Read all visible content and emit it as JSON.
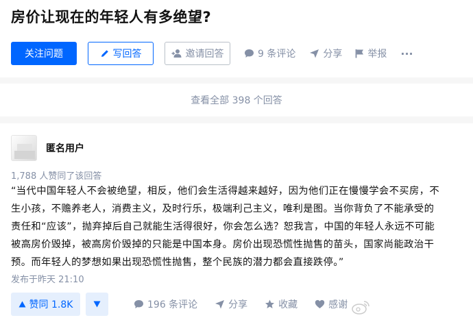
{
  "question": {
    "title": "房价让现在的年轻人有多绝望?",
    "follow_label": "关注问题",
    "write_label": "写回答",
    "invite_label": "邀请回答",
    "comments_label": "9 条评论",
    "share_label": "分享",
    "report_label": "举报",
    "more_label": "···"
  },
  "view_all": {
    "label": "查看全部 398 个回答"
  },
  "answer": {
    "author": "匿名用户",
    "votes_text": "1,788 人赞同了该回答",
    "content_lines": [
      "“当代中国年轻人不会被绝望，相反，他们会生活得越来越好，因为他们正在慢慢学会不买房，不",
      "生小孩，不赡养老人，消费主义，及时行乐，极端利己主义，唯利是图。当你背负了不能承受的",
      "责任和“应该”，抛弃掉后自己就能生活得很好，你会怎么选？恕我言，中国的年轻人永远不可能",
      "被高房价毁掉，被高房价毁掉的只能是中国本身。房价出现恐慌性抛售的苗头，国家尚能政治干",
      "预。而年轻人的梦想如果出现恐慌性抛售，整个民族的潜力都会直接跌停。”"
    ],
    "date": "发布于昨天 21:10",
    "upvote_label": "赞同 1.8K",
    "comments_label": "196 条评论",
    "share_label": "分享",
    "favorite_label": "收藏",
    "thanks_label": "感谢"
  },
  "colors": {
    "accent": "#0066ff",
    "muted": "#8590a6",
    "text": "#121212",
    "vote_bg": "#e5effd"
  },
  "icons": [
    "pencil-icon",
    "invite-user-icon",
    "comment-icon",
    "share-icon",
    "flag-icon",
    "triangle-up-icon",
    "triangle-down-icon",
    "star-icon",
    "heart-icon",
    "weibo-watermark-icon"
  ]
}
